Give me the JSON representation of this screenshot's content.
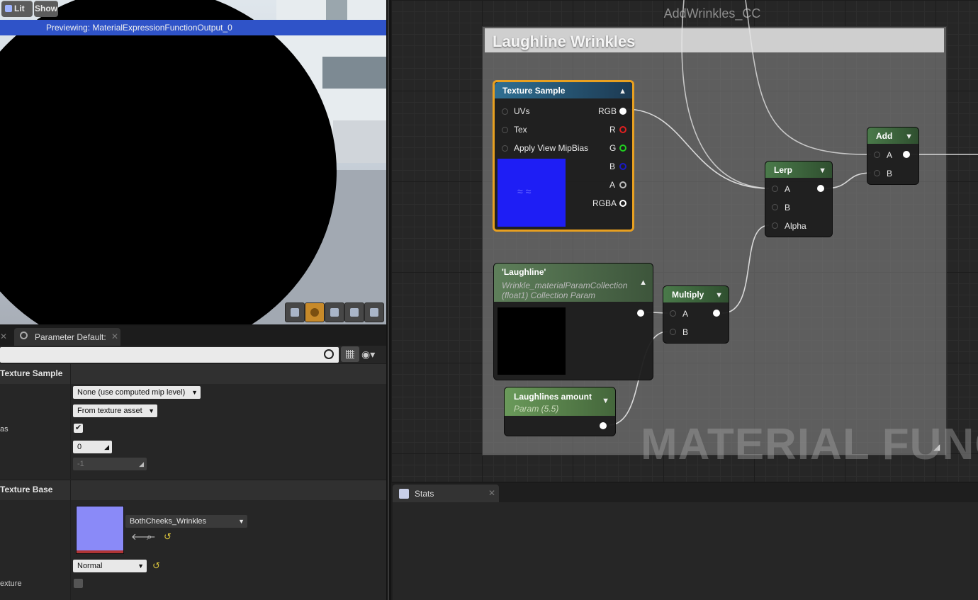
{
  "viewport": {
    "lit_label": "Lit",
    "show_label": "Show",
    "previewing_text": "Previewing: MaterialExpressionFunctionOutput_0"
  },
  "details": {
    "tab_label": "Parameter Default:",
    "search_placeholder": "",
    "texture_sample": {
      "category": "Texture Sample",
      "mip_value_mode": "None (use computed mip level)",
      "sampler_source": "From texture asset",
      "mipbias_label": "as",
      "apply_view_mipbias_checked": true,
      "const_coordinate": "0",
      "const_mip_value": "-1"
    },
    "texture_base": {
      "category": "Texture Base",
      "texture_name": "BothCheeks_Wrinkles",
      "sampler_type": "Normal",
      "is_default_label": "exture"
    }
  },
  "graph": {
    "title": "AddWrinkles_CC",
    "comment_title": "Laughline Wrinkles",
    "watermark": "MATERIAL FUNCTIO",
    "texture_sample_node": {
      "title": "Texture Sample",
      "inputs": [
        "UVs",
        "Tex",
        "Apply View MipBias"
      ],
      "outputs": [
        "RGB",
        "R",
        "G",
        "B",
        "A",
        "RGBA"
      ],
      "output_colors": {
        "RGB": "#ffffff",
        "R": "#e02020",
        "G": "#20d020",
        "B": "#1a1ac8",
        "A": "#bbbbbb",
        "RGBA": "#ffffff"
      }
    },
    "collection_param_node": {
      "title": "'Laughline'",
      "subtitle1": "Wrinkle_materialParamCollection",
      "subtitle2": "(float1) Collection Param"
    },
    "scalar_param_node": {
      "title": "Laughlines amount",
      "subtitle": "Param (5.5)"
    },
    "multiply_node": {
      "title": "Multiply",
      "inputs": [
        "A",
        "B"
      ]
    },
    "lerp_node": {
      "title": "Lerp",
      "inputs": [
        "A",
        "B",
        "Alpha"
      ]
    },
    "add_node": {
      "title": "Add",
      "inputs": [
        "A",
        "B"
      ]
    }
  },
  "stats": {
    "tab_label": "Stats"
  },
  "colors": {
    "selection_outline": "#e8a020",
    "texture_header": "#2f6f92",
    "param_header": "#5a8a4f",
    "math_header": "#4a7a4a",
    "preview_bar": "#2f53c8"
  }
}
